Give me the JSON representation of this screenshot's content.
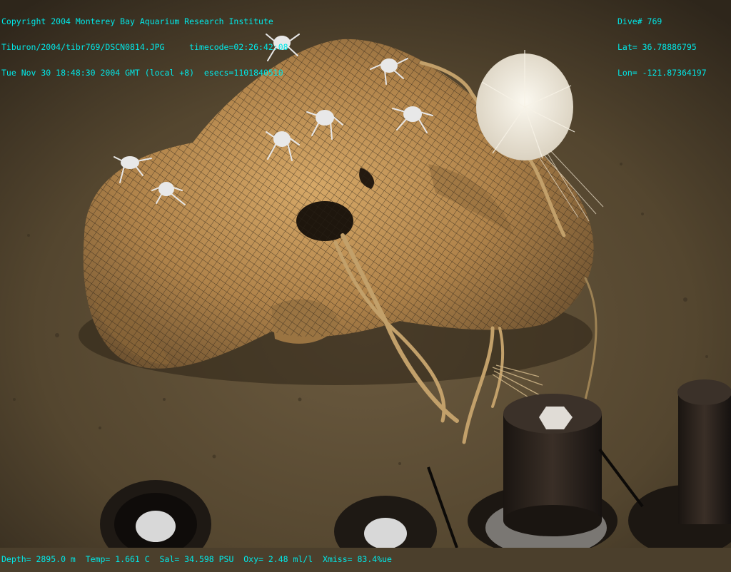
{
  "overlay": {
    "top_left": {
      "line1": "Copyright 2004 Monterey Bay Aquarium Research Institute",
      "line2": "Tiburon/2004/tibr769/DSCN0814.JPG     timecode=02:26:42:08",
      "line3": "Tue Nov 30 18:48:30 2004 GMT (local +8)  esecs=1101840510"
    },
    "top_right": {
      "dive": "Dive# 769",
      "lat": "Lat= 36.78886795",
      "lon": "Lon= -121.87364197"
    },
    "bottom": {
      "readout": "Depth= 2895.0 m  Temp= 1.661 C  Sal= 34.598 PSU  Oxy= 2.48 ml/l  Xmiss= 83.4%ue"
    }
  },
  "colors": {
    "overlay_text": "#00e8e8",
    "sediment": "#5a4a33",
    "whale_bone": "#b98a4e",
    "rope": "#c9a56b",
    "crab": "#e6e6e6",
    "sponge": "#efe9dc",
    "sampler": "#2a221c"
  }
}
